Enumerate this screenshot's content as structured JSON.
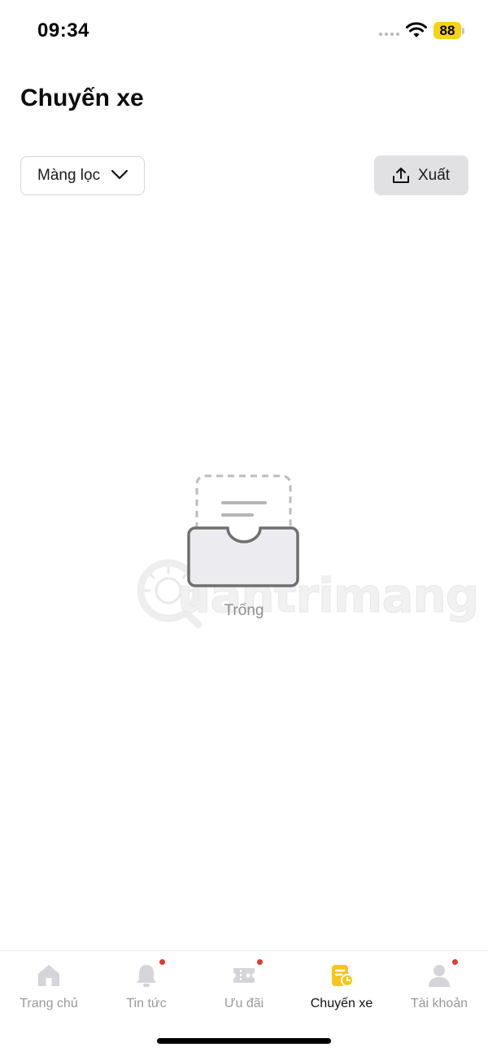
{
  "status_bar": {
    "time": "09:34",
    "battery": "88"
  },
  "header": {
    "title": "Chuyến xe"
  },
  "toolbar": {
    "filter_label": "Màng lọc",
    "export_label": "Xuất"
  },
  "empty_state": {
    "label": "Trống"
  },
  "watermark": {
    "text": "uantrimang"
  },
  "tabs": [
    {
      "label": "Trang chủ",
      "icon": "home-icon",
      "badge": false,
      "active": false
    },
    {
      "label": "Tin tức",
      "icon": "bell-icon",
      "badge": true,
      "active": false
    },
    {
      "label": "Ưu đãi",
      "icon": "ticket-icon",
      "badge": true,
      "active": false
    },
    {
      "label": "Chuyến xe",
      "icon": "trip-history-icon",
      "badge": false,
      "active": true
    },
    {
      "label": "Tài khoản",
      "icon": "user-icon",
      "badge": true,
      "active": false
    }
  ],
  "colors": {
    "accent": "#f7c518",
    "badge": "#e53935",
    "inactive": "#d5d5d9"
  }
}
